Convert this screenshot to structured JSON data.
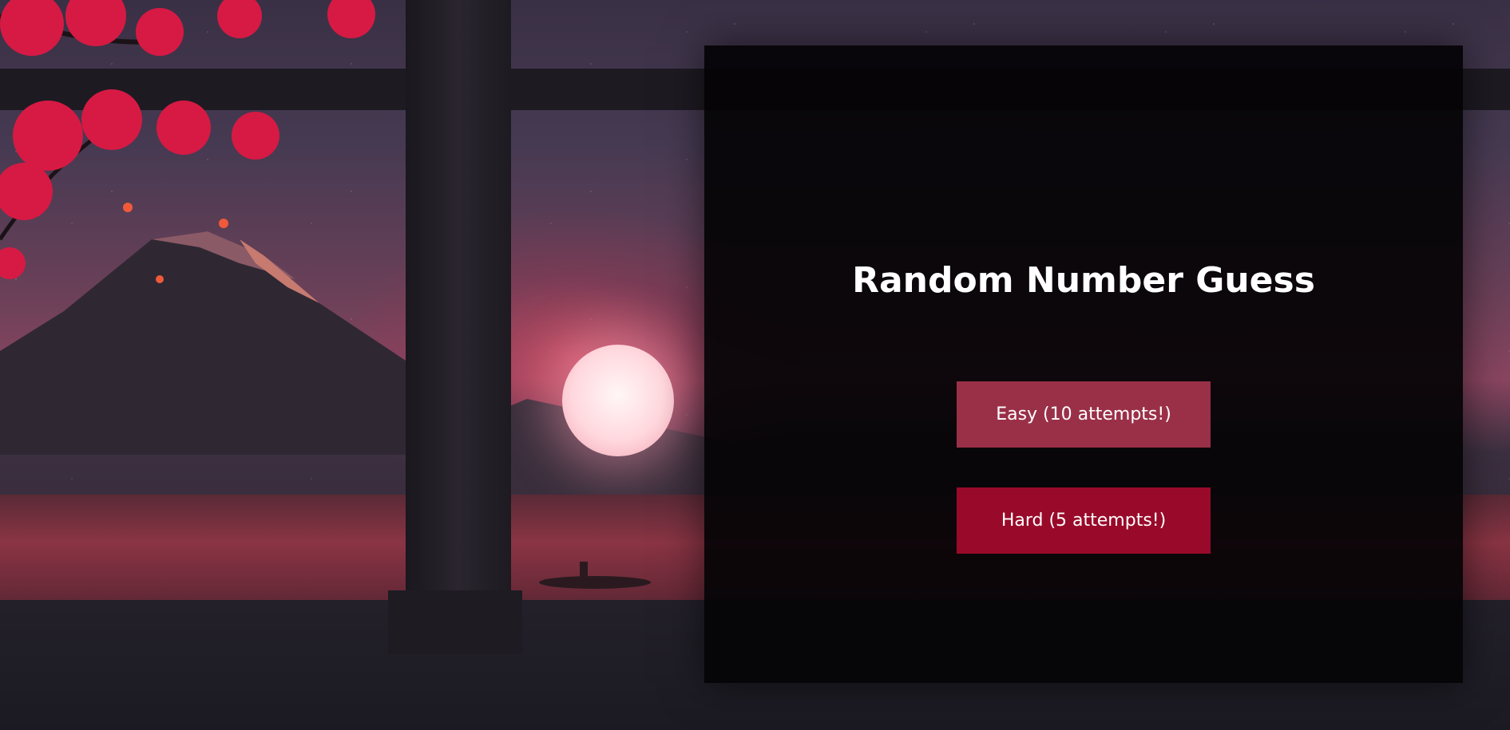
{
  "page": {
    "title": "Random Number Guess"
  },
  "difficulty": {
    "easy_label": "Easy (10 attempts!)",
    "hard_label": "Hard (5 attempts!)"
  },
  "colors": {
    "easy_button": "#9a3048",
    "hard_button": "#990a2a",
    "panel": "#040305"
  }
}
